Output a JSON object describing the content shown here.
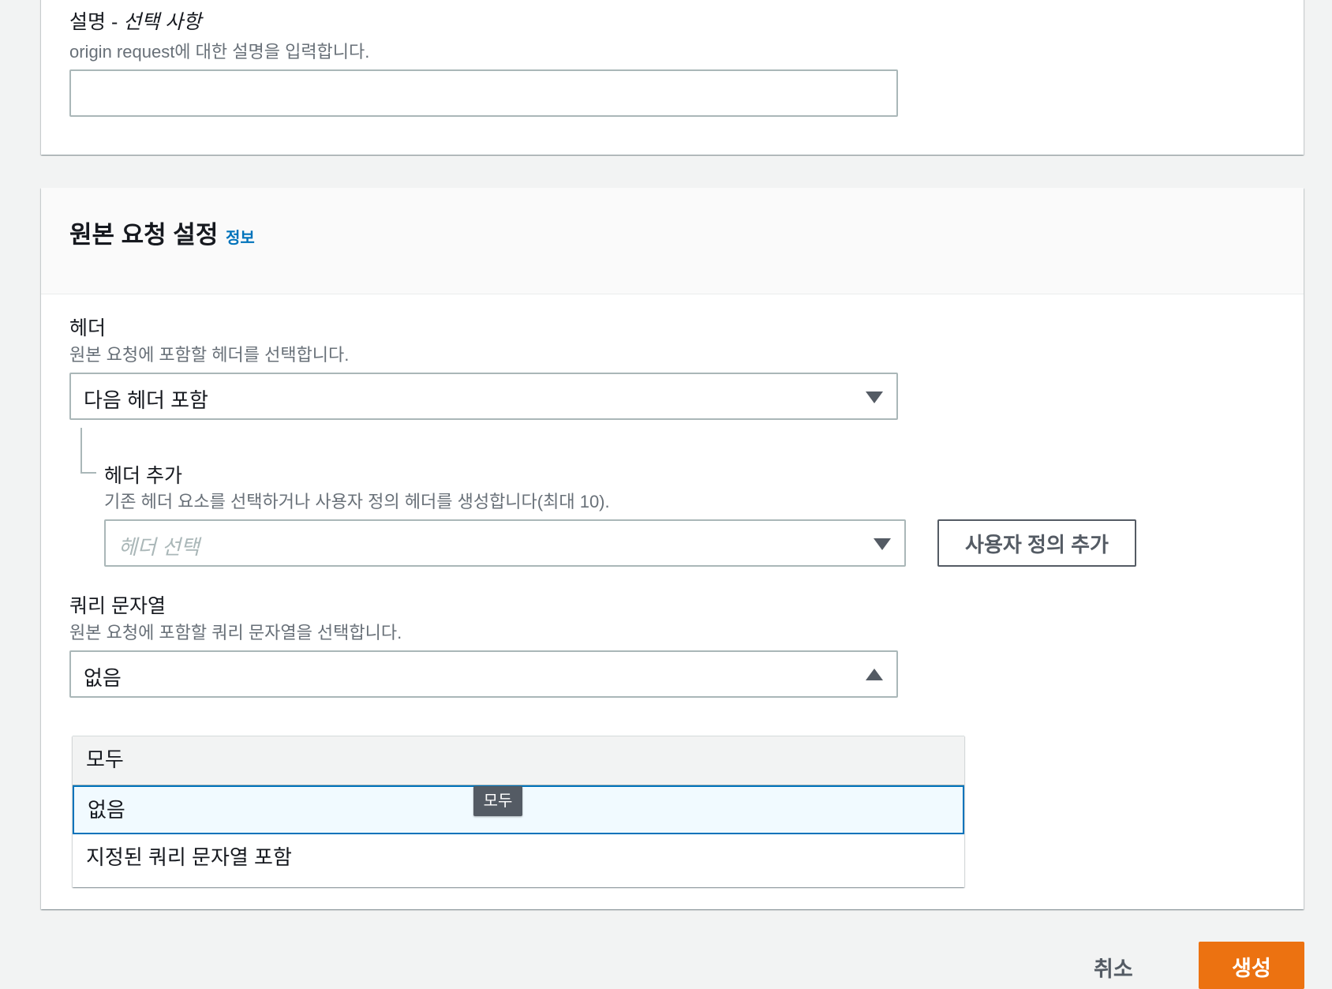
{
  "description_section": {
    "label_main": "설명 - ",
    "label_optional": "선택 사항",
    "help": "origin request에 대한 설명을 입력합니다.",
    "value": ""
  },
  "origin_request_settings": {
    "title": "원본 요청 설정",
    "info_link": "정보",
    "headers": {
      "label": "헤더",
      "help": "원본 요청에 포함할 헤더를 선택합니다.",
      "selected": "다음 헤더 포함",
      "add_headers": {
        "label": "헤더 추가",
        "help": "기존 헤더 요소를 선택하거나 사용자 정의 헤더를 생성합니다(최대 10).",
        "placeholder": "헤더 선택",
        "add_custom_button": "사용자 정의 추가"
      }
    },
    "query_strings": {
      "label": "쿼리 문자열",
      "help": "원본 요청에 포함할 쿼리 문자열을 선택합니다.",
      "selected": "없음",
      "options": [
        "모두",
        "없음",
        "지정된 쿼리 문자열 포함"
      ],
      "tooltip": "모두"
    }
  },
  "footer": {
    "cancel": "취소",
    "create": "생성"
  },
  "colors": {
    "primary_button": "#ec7211",
    "link": "#0073bb",
    "selected_option_border": "#0073bb"
  }
}
